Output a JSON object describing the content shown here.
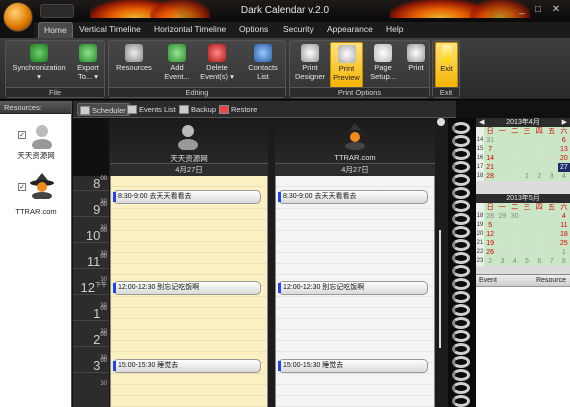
{
  "window": {
    "title": "Dark Calendar v.2.0",
    "controls": [
      "_",
      "□",
      "✕"
    ]
  },
  "menu": [
    "Home",
    "Vertical Timeline",
    "Horizontal Timeline",
    "Options",
    "Security",
    "Appearance",
    "Help"
  ],
  "ribbon": {
    "groups": [
      {
        "label": "File",
        "buttons": [
          {
            "label": "Synchronization",
            "sub": "▾"
          },
          {
            "label": "Export",
            "sub": "To... ▾"
          }
        ]
      },
      {
        "label": "Editing",
        "buttons": [
          {
            "label": "Resources",
            "sub": ""
          },
          {
            "label": "Add",
            "sub": "Event..."
          },
          {
            "label": "Delete",
            "sub": "Event(s) ▾"
          },
          {
            "label": "Contacts",
            "sub": "List"
          }
        ]
      },
      {
        "label": "Print Options",
        "buttons": [
          {
            "label": "Print",
            "sub": "Designer"
          },
          {
            "label": "Print",
            "sub": "Preview"
          },
          {
            "label": "Page",
            "sub": "Setup..."
          },
          {
            "label": "Print",
            "sub": ""
          }
        ]
      },
      {
        "label": "Exit",
        "buttons": [
          {
            "label": "Exit",
            "sub": ""
          }
        ]
      }
    ]
  },
  "resources": {
    "header": "Resources:",
    "items": [
      {
        "name": "天天资源网",
        "checked": "✓"
      },
      {
        "name": "TTRAR.com",
        "checked": "✓"
      }
    ]
  },
  "tabs": [
    "Scheduler",
    "Events List",
    "Backup",
    "Restore"
  ],
  "scheduler": {
    "columns": [
      {
        "name": "天天资源网",
        "date": "4月27日"
      },
      {
        "name": "TTRAR.com",
        "date": "4月27日"
      }
    ],
    "times": [
      {
        "h": "8",
        "m": "00"
      },
      {
        "h": "9",
        "m": "00"
      },
      {
        "h": "10",
        "m": "00"
      },
      {
        "h": "11",
        "m": "00"
      },
      {
        "h": "12",
        "m": "下午"
      },
      {
        "h": "1",
        "m": "00"
      },
      {
        "h": "2",
        "m": "00"
      },
      {
        "h": "3",
        "m": "00"
      }
    ],
    "half": "30",
    "events": [
      {
        "col": 0,
        "text": "8:30-9:00 去天天看看去"
      },
      {
        "col": 1,
        "text": "8:30-9:00 去天天看看去"
      },
      {
        "col": 0,
        "text": "12:00-12:30 别忘记吃饭啊"
      },
      {
        "col": 1,
        "text": "12:00-12:30 别忘记吃饭啊"
      },
      {
        "col": 0,
        "text": "15:00-15:30 睡觉去"
      },
      {
        "col": 1,
        "text": "15:00-15:30 睡觉去"
      }
    ],
    "col_colors": [
      "#fbf0c1",
      "#f4f4f4"
    ]
  },
  "calendar": {
    "april": {
      "title": "2013年4月",
      "dow": [
        "日",
        "一",
        "二",
        "三",
        "四",
        "五",
        "六"
      ],
      "weeks": [
        [
          "14",
          "31",
          "1",
          "2",
          "3",
          "4",
          "5",
          "6"
        ],
        [
          "15",
          "7",
          "8",
          "9",
          "10",
          "11",
          "12",
          "13"
        ],
        [
          "16",
          "14",
          "15",
          "16",
          "17",
          "18",
          "19",
          "20"
        ],
        [
          "17",
          "21",
          "22",
          "23",
          "24",
          "25",
          "26",
          "27"
        ],
        [
          "18",
          "28",
          "29",
          "30",
          "1",
          "2",
          "3",
          "4"
        ]
      ]
    },
    "may": {
      "title": "2013年5月",
      "dow": [
        "日",
        "一",
        "二",
        "三",
        "四",
        "五",
        "六"
      ],
      "weeks": [
        [
          "18",
          "28",
          "29",
          "30",
          "1",
          "2",
          "3",
          "4"
        ],
        [
          "19",
          "5",
          "6",
          "7",
          "8",
          "9",
          "10",
          "11"
        ],
        [
          "20",
          "12",
          "13",
          "14",
          "15",
          "16",
          "17",
          "18"
        ],
        [
          "21",
          "19",
          "20",
          "21",
          "22",
          "23",
          "24",
          "25"
        ],
        [
          "22",
          "26",
          "27",
          "28",
          "29",
          "30",
          "31",
          "1"
        ],
        [
          "23",
          "2",
          "3",
          "4",
          "5",
          "6",
          "7",
          "8"
        ]
      ]
    },
    "nav": {
      "prev": "◀",
      "next": "▶"
    }
  },
  "event_list": {
    "columns": [
      "Event",
      "Resource"
    ]
  },
  "colors": {
    "accent": "#f4b400",
    "today": "#1d2c66",
    "event_bar": "#2244ee"
  }
}
